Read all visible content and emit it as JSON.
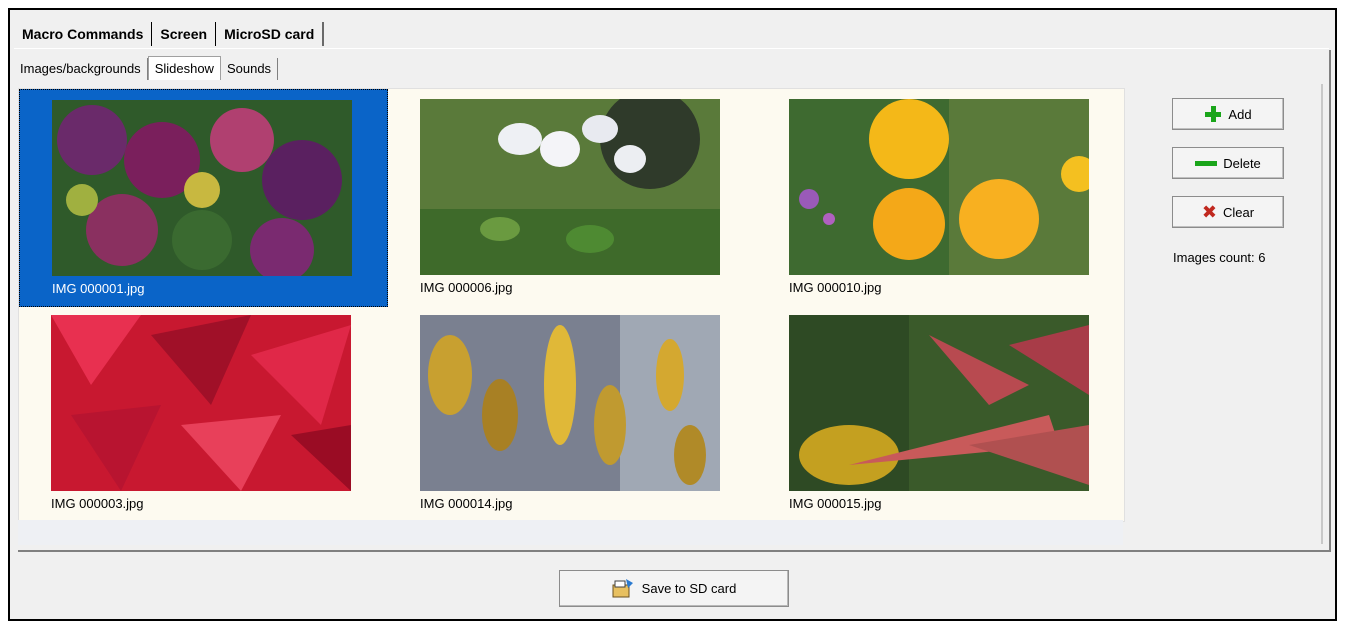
{
  "tabs_main": [
    "Macro Commands",
    "Screen",
    "MicroSD card"
  ],
  "tabs_sub": [
    "Images/backgrounds",
    "Slideshow",
    "Sounds"
  ],
  "images": [
    {
      "caption": "IMG 000001.jpg"
    },
    {
      "caption": "IMG 000006.jpg"
    },
    {
      "caption": "IMG 000010.jpg"
    },
    {
      "caption": "IMG 000003.jpg"
    },
    {
      "caption": "IMG 000014.jpg"
    },
    {
      "caption": "IMG 000015.jpg"
    }
  ],
  "buttons": {
    "add": "Add",
    "delete": "Delete",
    "clear": "Clear",
    "save": "Save to SD card"
  },
  "images_count": "Images count: 6",
  "colors": {
    "selection": "#0a64c8",
    "gallery_bg": "#fdfaf0",
    "icon_green": "#1aa51a",
    "icon_red": "#c0281e"
  }
}
